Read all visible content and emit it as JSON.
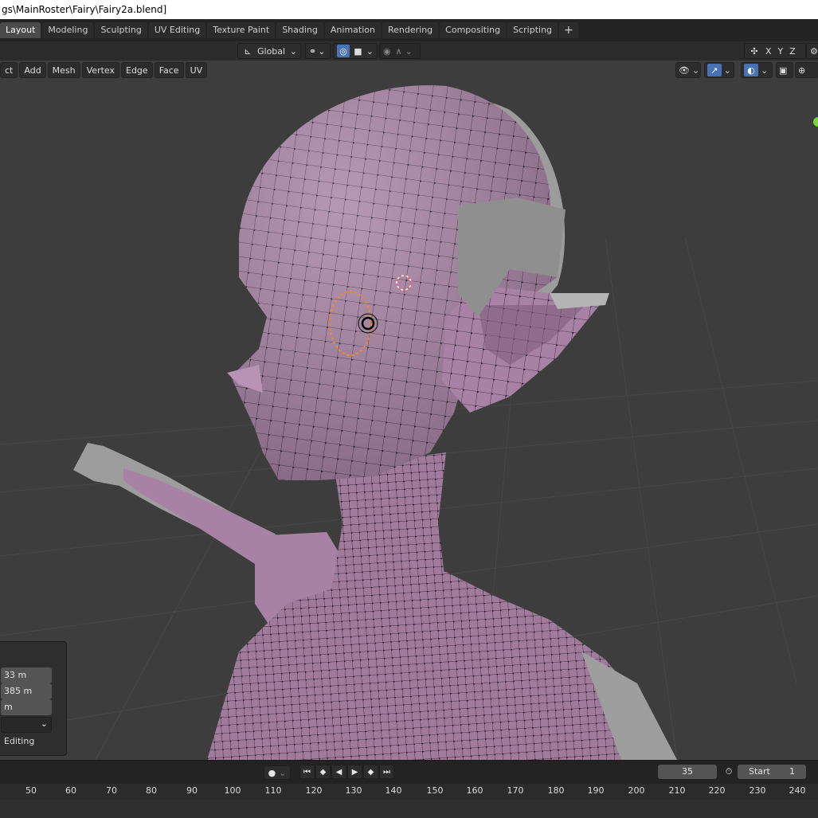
{
  "window": {
    "title": "gs\\MainRoster\\Fairy\\Fairy2a.blend]"
  },
  "workspace_tabs": [
    {
      "label": "Layout",
      "active": true
    },
    {
      "label": "Modeling"
    },
    {
      "label": "Sculpting"
    },
    {
      "label": "UV Editing"
    },
    {
      "label": "Texture Paint"
    },
    {
      "label": "Shading"
    },
    {
      "label": "Animation"
    },
    {
      "label": "Rendering"
    },
    {
      "label": "Compositing"
    },
    {
      "label": "Scripting"
    }
  ],
  "header": {
    "orientation": "Global",
    "axes": [
      "X",
      "Y",
      "Z"
    ]
  },
  "viewport_menus": [
    "ct",
    "Add",
    "Mesh",
    "Vertex",
    "Edge",
    "Face",
    "UV"
  ],
  "redo_panel": {
    "fields": [
      "33 m",
      "385 m",
      "m"
    ],
    "label": "Editing"
  },
  "timeline": {
    "current_frame": "35",
    "start_label": "Start",
    "start_value": "1",
    "ruler_ticks": [
      "50",
      "60",
      "70",
      "80",
      "90",
      "100",
      "110",
      "120",
      "130",
      "140",
      "150",
      "160",
      "170",
      "180",
      "190",
      "200",
      "210",
      "220",
      "230",
      "240"
    ]
  },
  "colors": {
    "active_tab": "#4b4b4b",
    "mesh_fill": "#a882a4",
    "wire": "#000000",
    "selection": "#f08a24",
    "accent_blue": "#4772b3",
    "green_dot": "#7cd63a"
  }
}
